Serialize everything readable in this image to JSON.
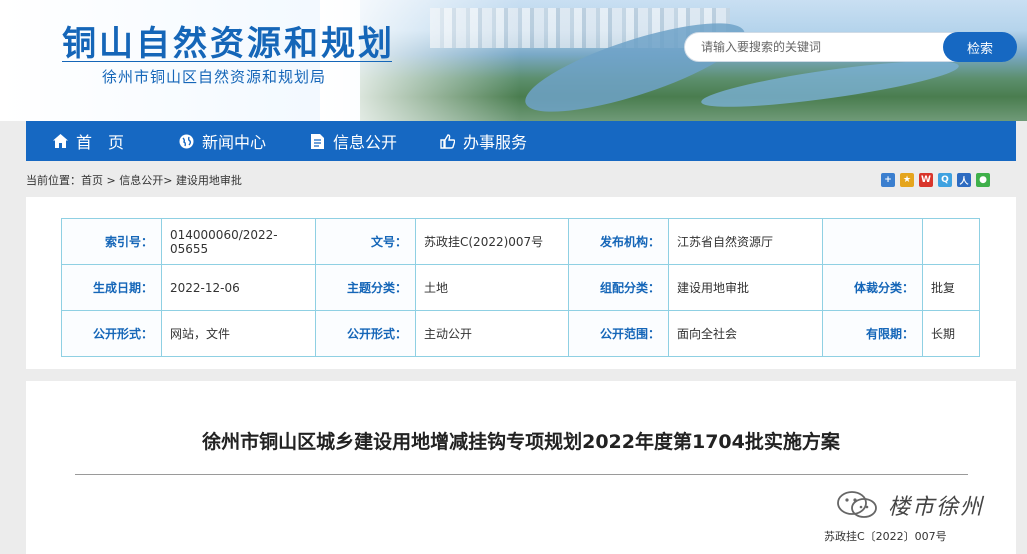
{
  "header": {
    "title": "铜山自然资源和规划",
    "subtitle": "徐州市铜山区自然资源和规划局",
    "search_placeholder": "请输入要搜索的关键词",
    "search_button": "检索"
  },
  "nav": {
    "items": [
      {
        "label": "首　页",
        "icon": "home-icon"
      },
      {
        "label": "新闻中心",
        "icon": "globe-icon"
      },
      {
        "label": "信息公开",
        "icon": "document-icon"
      },
      {
        "label": "办事服务",
        "icon": "thumbs-up-icon"
      }
    ]
  },
  "breadcrumb": {
    "prefix": "当前位置：",
    "home": "首页",
    "sep1": " > ",
    "section": "信息公开",
    "sep2": "> ",
    "current": "建设用地审批"
  },
  "share_icons": [
    "add-icon",
    "star-icon",
    "weibo-icon",
    "qzone-icon",
    "renren-icon",
    "wechat-icon"
  ],
  "meta": {
    "rows": [
      [
        {
          "label": "索引号：",
          "value": "014000060/2022-05655"
        },
        {
          "label": "文号：",
          "value": "苏政挂C(2022)007号"
        },
        {
          "label": "发布机构：",
          "value": "江苏省自然资源厅"
        },
        {
          "label": "",
          "value": ""
        }
      ],
      [
        {
          "label": "生成日期：",
          "value": "2022-12-06"
        },
        {
          "label": "主题分类：",
          "value": "土地"
        },
        {
          "label": "组配分类：",
          "value": "建设用地审批"
        },
        {
          "label": "体裁分类：",
          "value": "批复"
        }
      ],
      [
        {
          "label": "公开形式：",
          "value": "网站，文件"
        },
        {
          "label": "公开形式：",
          "value": "主动公开"
        },
        {
          "label": "公开范围：",
          "value": "面向全社会"
        },
        {
          "label": "有限期：",
          "value": "长期"
        }
      ]
    ]
  },
  "document": {
    "title": "徐州市铜山区城乡建设用地增减挂钩专项规划2022年度第1704批实施方案",
    "number": "苏政挂C〔2022〕007号"
  },
  "watermark": {
    "text": "楼市徐州"
  },
  "colors": {
    "brand_blue": "#1668c2",
    "table_border": "#8fd0e3",
    "label_blue": "#1566b8"
  }
}
